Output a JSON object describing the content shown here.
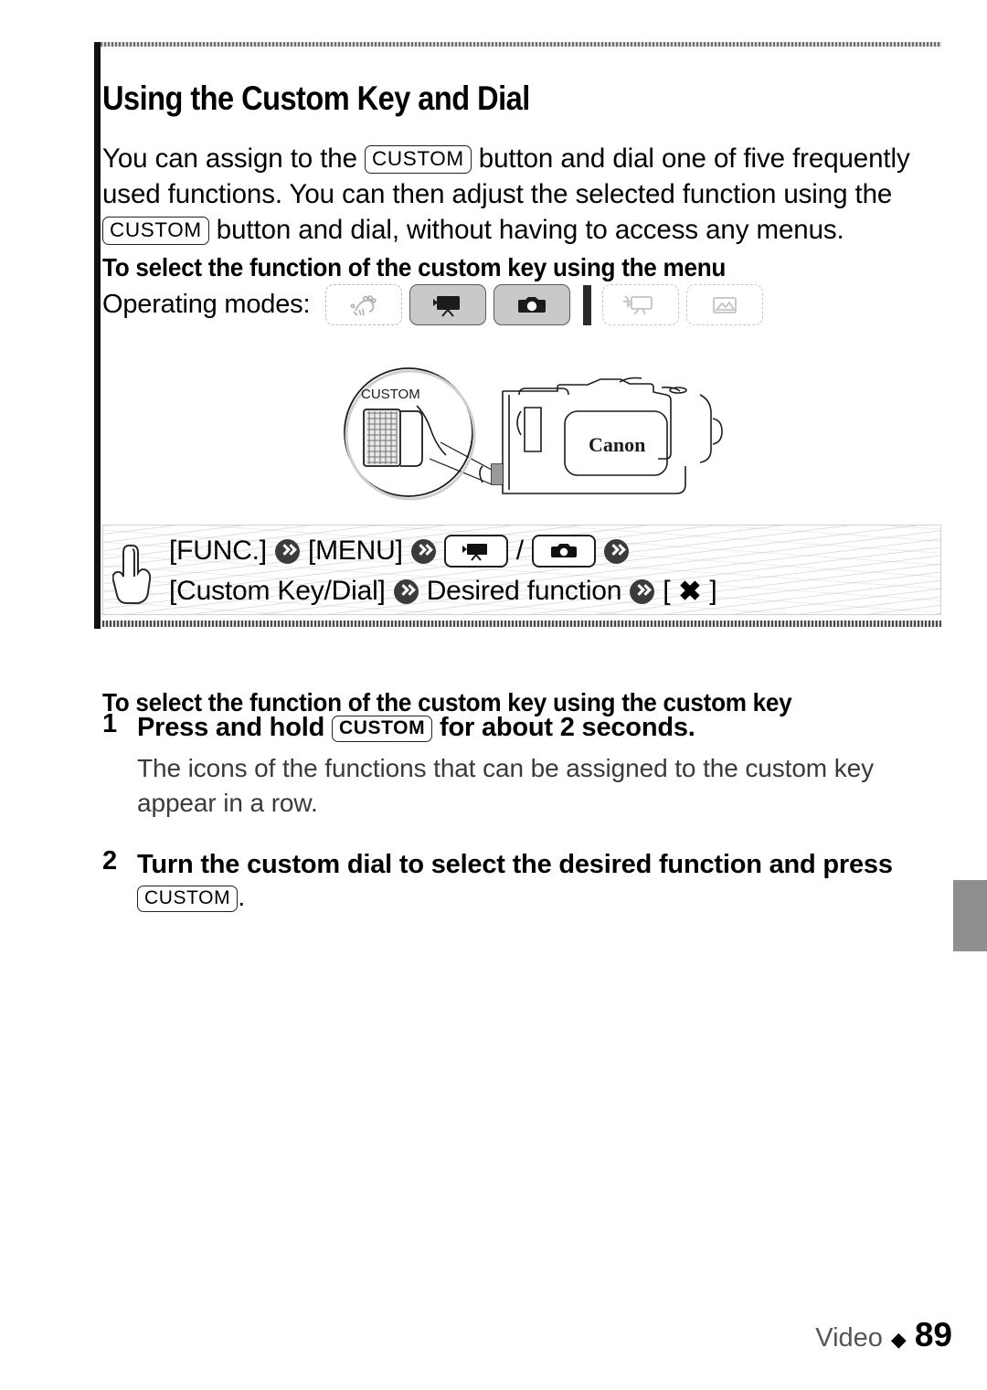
{
  "page": {
    "title": "Using the Custom Key and Dial",
    "footer": {
      "section_label": "Video",
      "separator": "◆",
      "page_number": "89"
    }
  },
  "intro": {
    "part1": "You can assign to the ",
    "kbd1": "CUSTOM",
    "part2": " button and dial one of five frequently used functions. You can then adjust the selected function using the ",
    "kbd2": "CUSTOM",
    "part3": " button and dial, without having to access any menus."
  },
  "subheads": {
    "menu": "To select the function of the custom key using the menu",
    "custom_key": "To select the function of the custom key using the custom key"
  },
  "operating_modes": {
    "label": "Operating modes:",
    "badges": [
      {
        "icon": "auto-mode-icon",
        "state": "off"
      },
      {
        "icon": "movie-camera-icon",
        "state": "on"
      },
      {
        "icon": "still-camera-icon",
        "state": "on"
      },
      {
        "icon": "movie-playback-icon",
        "state": "dim"
      },
      {
        "icon": "photo-playback-icon",
        "state": "dim"
      }
    ]
  },
  "illustration": {
    "callout_label": "CUSTOM",
    "brand_label": "Canon"
  },
  "menu_path": {
    "hand_icon": "pointing-hand-icon",
    "line1": {
      "func": "[FUNC.]",
      "menu": "[MENU]",
      "slash": "/",
      "icon_movie": "movie-camera-icon",
      "icon_photo": "still-camera-icon"
    },
    "line2": {
      "custom_key_dial": "[Custom Key/Dial]",
      "desired_function": "Desired function",
      "close_open": "[",
      "close_icon": "✖",
      "close_close": "]"
    }
  },
  "steps": [
    {
      "number": "1",
      "text_before": "Press and hold ",
      "kbd": "CUSTOM",
      "text_after": " for about 2 seconds.",
      "note": "The icons of the functions that can be assigned to the custom key appear in a row."
    },
    {
      "number": "2",
      "text": "Turn the custom dial to select the desired function and press",
      "kbd": "CUSTOM",
      "trailing": "."
    }
  ]
}
